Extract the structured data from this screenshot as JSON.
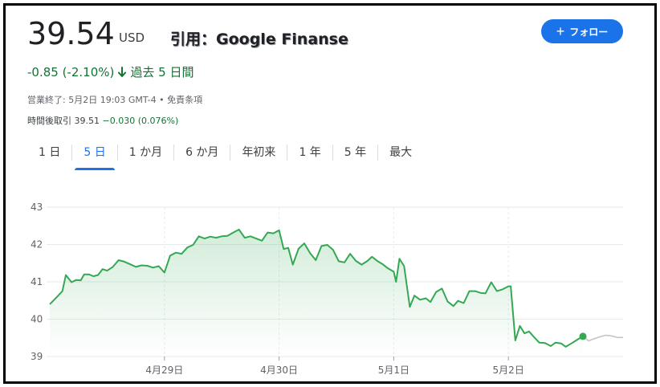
{
  "quote": {
    "price": "39.54",
    "currency": "USD",
    "source_label": "引用：Google Finanse",
    "change_text": "-0.85 (-2.10%)",
    "change_period": "過去 5 日間",
    "market_status": "営業終了: 5月2日 19:03 GMT-4 • 免責条項",
    "after_hours_label": "時間後取引 39.51",
    "after_hours_change": "−0.030 (0.076%)",
    "follow_label": "フォロー",
    "accent_color": "#1a73e8",
    "down_color": "#137333"
  },
  "tabs": [
    {
      "label": "1 日",
      "active": false
    },
    {
      "label": "5 日",
      "active": true
    },
    {
      "label": "1 か月",
      "active": false
    },
    {
      "label": "6 か月",
      "active": false
    },
    {
      "label": "年初来",
      "active": false
    },
    {
      "label": "1 年",
      "active": false
    },
    {
      "label": "5 年",
      "active": false
    },
    {
      "label": "最大",
      "active": false
    }
  ],
  "chart_data": {
    "type": "area",
    "title": "",
    "xlabel": "",
    "ylabel": "",
    "ylim": [
      39,
      43
    ],
    "xlim": [
      0,
      5
    ],
    "yticks": [
      39,
      40,
      41,
      42,
      43
    ],
    "xticks": [
      {
        "value": 1,
        "label": "4月29日"
      },
      {
        "value": 2,
        "label": "4月30日"
      },
      {
        "value": 3,
        "label": "5月1日"
      },
      {
        "value": 4,
        "label": "5月2日"
      }
    ],
    "grid": true,
    "line_color": "#34a853",
    "after_hours_color": "#c4c4c4",
    "series": [
      {
        "values": [
          [
            0.0,
            40.4
          ],
          [
            0.07,
            40.62
          ],
          [
            0.11,
            40.75
          ],
          [
            0.14,
            41.18
          ],
          [
            0.19,
            40.99
          ],
          [
            0.23,
            41.05
          ],
          [
            0.27,
            41.04
          ],
          [
            0.3,
            41.2
          ],
          [
            0.34,
            41.2
          ],
          [
            0.38,
            41.15
          ],
          [
            0.42,
            41.18
          ],
          [
            0.46,
            41.34
          ],
          [
            0.5,
            41.3
          ],
          [
            0.55,
            41.4
          ],
          [
            0.6,
            41.58
          ],
          [
            0.65,
            41.54
          ],
          [
            0.7,
            41.47
          ],
          [
            0.75,
            41.4
          ],
          [
            0.8,
            41.44
          ],
          [
            0.85,
            41.43
          ],
          [
            0.9,
            41.38
          ],
          [
            0.95,
            41.42
          ],
          [
            1.0,
            41.25
          ],
          [
            1.05,
            41.7
          ],
          [
            1.1,
            41.78
          ],
          [
            1.15,
            41.75
          ],
          [
            1.2,
            41.92
          ],
          [
            1.25,
            41.99
          ],
          [
            1.3,
            42.22
          ],
          [
            1.35,
            42.16
          ],
          [
            1.4,
            42.21
          ],
          [
            1.45,
            42.18
          ],
          [
            1.5,
            42.22
          ],
          [
            1.55,
            42.23
          ],
          [
            1.6,
            42.32
          ],
          [
            1.65,
            42.4
          ],
          [
            1.7,
            42.18
          ],
          [
            1.75,
            42.22
          ],
          [
            1.8,
            42.16
          ],
          [
            1.85,
            42.1
          ],
          [
            1.9,
            42.32
          ],
          [
            1.95,
            42.3
          ],
          [
            2.0,
            42.38
          ],
          [
            2.04,
            41.88
          ],
          [
            2.08,
            41.91
          ],
          [
            2.12,
            41.46
          ],
          [
            2.17,
            41.89
          ],
          [
            2.22,
            42.03
          ],
          [
            2.27,
            41.77
          ],
          [
            2.32,
            41.58
          ],
          [
            2.37,
            41.96
          ],
          [
            2.42,
            41.99
          ],
          [
            2.47,
            41.86
          ],
          [
            2.52,
            41.55
          ],
          [
            2.57,
            41.52
          ],
          [
            2.62,
            41.75
          ],
          [
            2.67,
            41.56
          ],
          [
            2.72,
            41.46
          ],
          [
            2.77,
            41.56
          ],
          [
            2.81,
            41.67
          ],
          [
            2.86,
            41.55
          ],
          [
            2.9,
            41.48
          ],
          [
            2.95,
            41.36
          ],
          [
            3.0,
            41.27
          ],
          [
            3.02,
            41.0
          ],
          [
            3.05,
            41.62
          ],
          [
            3.09,
            41.42
          ],
          [
            3.14,
            40.33
          ],
          [
            3.18,
            40.63
          ],
          [
            3.23,
            40.52
          ],
          [
            3.28,
            40.56
          ],
          [
            3.32,
            40.46
          ],
          [
            3.37,
            40.73
          ],
          [
            3.42,
            40.82
          ],
          [
            3.47,
            40.47
          ],
          [
            3.52,
            40.35
          ],
          [
            3.56,
            40.49
          ],
          [
            3.61,
            40.43
          ],
          [
            3.66,
            40.75
          ],
          [
            3.71,
            40.75
          ],
          [
            3.76,
            40.7
          ],
          [
            3.8,
            40.69
          ],
          [
            3.85,
            40.99
          ],
          [
            3.9,
            40.75
          ],
          [
            3.95,
            40.8
          ],
          [
            4.0,
            40.88
          ],
          [
            4.02,
            40.88
          ],
          [
            4.06,
            39.43
          ],
          [
            4.1,
            39.82
          ],
          [
            4.14,
            39.62
          ],
          [
            4.18,
            39.67
          ],
          [
            4.23,
            39.5
          ],
          [
            4.27,
            39.37
          ],
          [
            4.32,
            39.36
          ],
          [
            4.37,
            39.28
          ],
          [
            4.41,
            39.37
          ],
          [
            4.46,
            39.35
          ],
          [
            4.5,
            39.26
          ],
          [
            4.55,
            39.35
          ],
          [
            4.6,
            39.45
          ],
          [
            4.65,
            39.54
          ]
        ]
      },
      {
        "values": [
          [
            4.65,
            39.54
          ],
          [
            4.7,
            39.42
          ],
          [
            4.75,
            39.48
          ],
          [
            4.8,
            39.53
          ],
          [
            4.85,
            39.57
          ],
          [
            4.9,
            39.55
          ],
          [
            4.95,
            39.51
          ],
          [
            5.0,
            39.51
          ]
        ]
      }
    ]
  }
}
